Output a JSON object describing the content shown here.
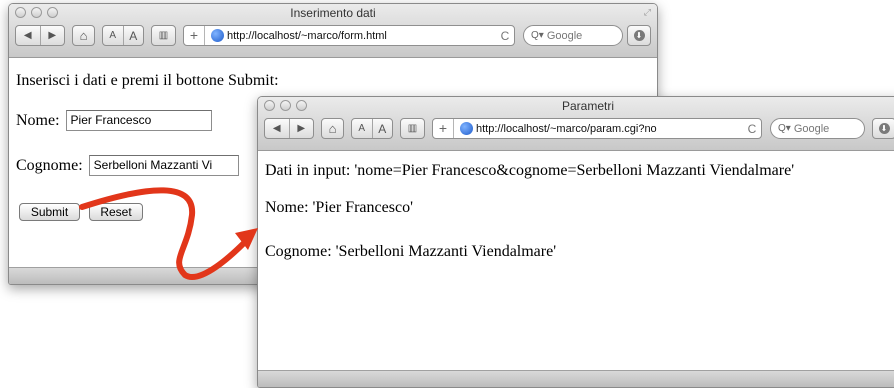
{
  "window_form": {
    "title": "Inserimento dati",
    "address": "http://localhost/~marco/form.html",
    "search_placeholder": "Google",
    "toolbar": {
      "back": "◀",
      "forward": "▶",
      "home": "⌂",
      "text_small": "A",
      "text_large": "A",
      "bookmarks": "▥",
      "new_tab": "+",
      "reload": "C"
    },
    "intro": "Inserisci i dati e premi il bottone Submit:",
    "nome_label": "Nome:",
    "nome_value": "Pier Francesco",
    "cognome_label": "Cognome:",
    "cognome_value": "Serbelloni Mazzanti Vi",
    "submit_label": "Submit",
    "reset_label": "Reset"
  },
  "window_params": {
    "title": "Parametri",
    "address": "http://localhost/~marco/param.cgi?no",
    "search_placeholder": "Google",
    "toolbar": {
      "back": "◀",
      "forward": "▶",
      "home": "⌂",
      "text_small": "A",
      "text_large": "A",
      "bookmarks": "▥",
      "new_tab": "+",
      "reload": "C"
    },
    "input_line": "Dati in input: 'nome=Pier Francesco&cognome=Serbelloni Mazzanti Viendalmare'",
    "nome_line": "Nome: 'Pier Francesco'",
    "cognome_line": "Cognome: 'Serbelloni Mazzanti Viendalmare'"
  },
  "colors": {
    "arrow": "#e2361a",
    "titlebar_top": "#ebebeb",
    "titlebar_bottom": "#c8c8c8"
  },
  "icons": {
    "nav": "arrow-icons",
    "globe": "globe-icon",
    "download": "download-icon",
    "search": "magnifier-icon"
  }
}
